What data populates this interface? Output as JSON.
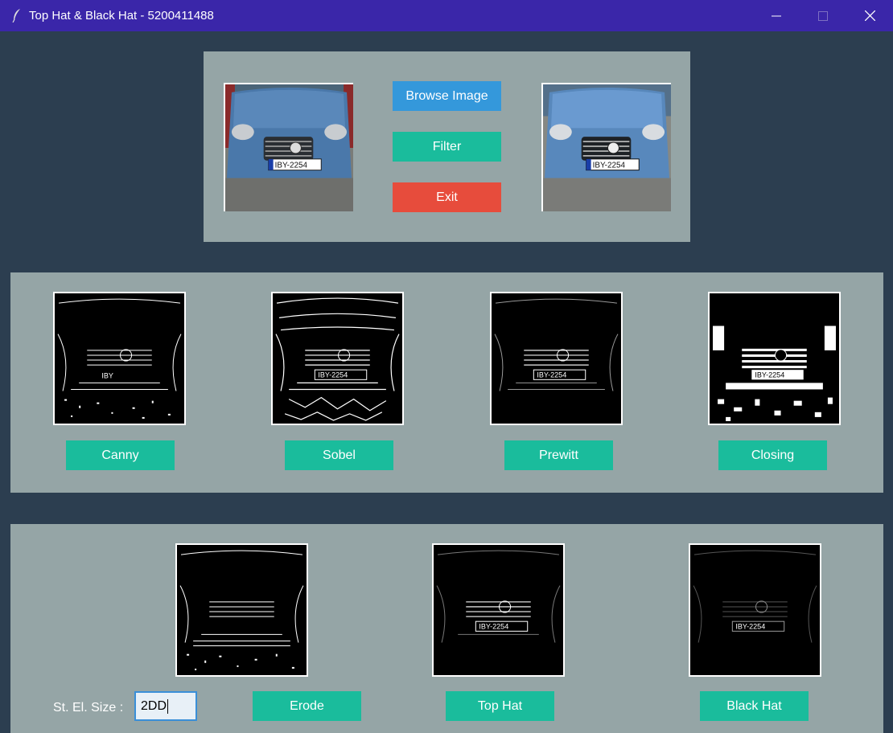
{
  "window": {
    "title": "Top Hat & Black Hat - 5200411488"
  },
  "top_panel": {
    "browse_label": "Browse Image",
    "filter_label": "Filter",
    "exit_label": "Exit",
    "original_plate": "IBY-2254",
    "filtered_plate": "IBY-2254"
  },
  "mid_panel": {
    "buttons": [
      "Canny",
      "Sobel",
      "Prewitt",
      "Closing"
    ],
    "plates": [
      "IBY",
      "IBY-2254",
      "IBY-2254",
      "IBY-2254"
    ]
  },
  "bottom_panel": {
    "size_label": "St. El. Size :",
    "size_value": "2DD",
    "buttons": [
      "Erode",
      "Top Hat",
      "Black Hat"
    ],
    "plates": [
      "",
      "IBY-2254",
      "IBY-2254"
    ]
  },
  "colors": {
    "bg": "#2c3e50",
    "panel": "#95a5a6",
    "teal": "#1abc9c",
    "blue": "#3498db",
    "red": "#e74c3c",
    "titlebar": "#3a26a9"
  }
}
